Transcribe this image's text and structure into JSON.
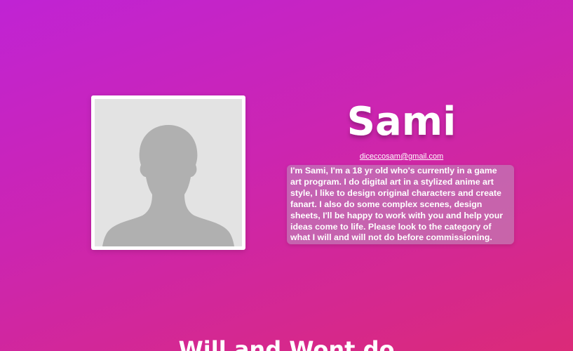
{
  "profile": {
    "name": "Sami",
    "email": "diceccosam@gmail.com",
    "bio": "I'm Sami, I'm a 18 yr old who's currently in a game art program. I do digital art in a stylized anime art style, I like to design original characters and create fanart. I also do some complex scenes, design sheets, I'll be happy to work with you and help your ideas come to life. Please look to the category of what I will and will not do before commissioning.",
    "avatar_icon": "person-silhouette-icon"
  },
  "sections": {
    "will_and_wont_heading": "Will and Wont do"
  },
  "colors": {
    "gradient_start": "#c023d4",
    "gradient_end": "#db2a78",
    "photo_bg": "#e3e3e3",
    "silhouette": "#b0b0b0"
  }
}
